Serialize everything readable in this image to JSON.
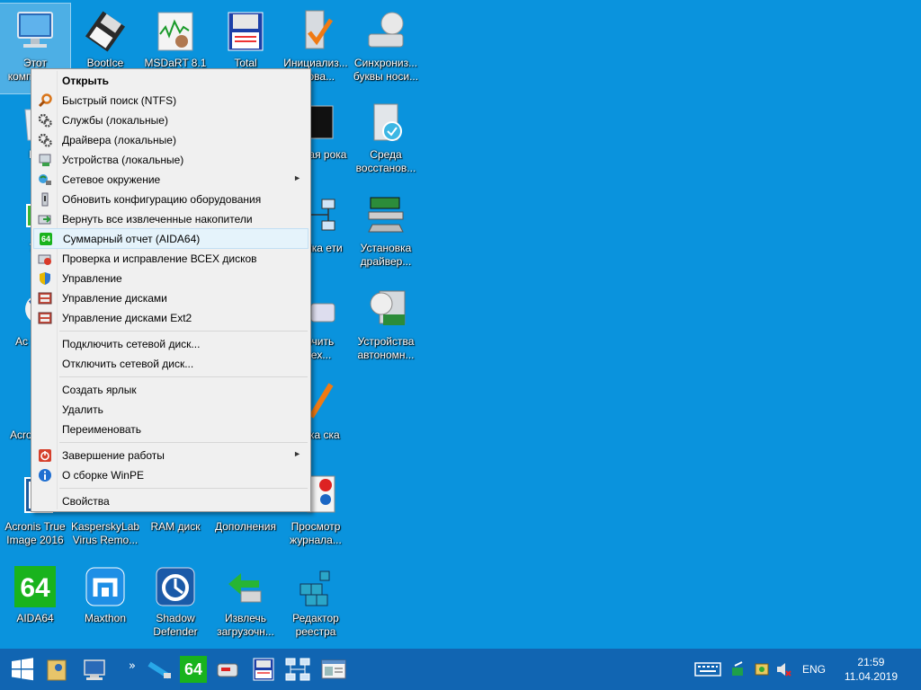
{
  "desktop": {
    "icons": [
      {
        "label": "Этот компьютер",
        "icon": "computer-icon"
      },
      {
        "label": "BootIce",
        "icon": "floppy-icon"
      },
      {
        "label": "MSDaRT 8.1",
        "icon": "msdart-icon"
      },
      {
        "label": "Total",
        "icon": "total-commander-icon"
      },
      {
        "label": "Инициализ... удова...",
        "icon": "init-icon"
      },
      {
        "label": "Синхрониз... буквы носи...",
        "icon": "sync-drives-icon"
      },
      {
        "label": "Ко",
        "icon": "recycle-bin-icon"
      },
      {
        "label": "андная рока",
        "icon": "cmd-icon"
      },
      {
        "label": "Среда восстанов...",
        "icon": "recovery-icon"
      },
      {
        "label": "78",
        "icon": "app-icon"
      },
      {
        "label": "тройка ети",
        "icon": "network-setup-icon"
      },
      {
        "label": "Установка драйвер...",
        "icon": "driver-install-icon"
      },
      {
        "label": "Ac Back",
        "icon": "acronis-backup-icon"
      },
      {
        "label": "лючить всех...",
        "icon": "drive-connect-icon"
      },
      {
        "label": "Устройства автономн...",
        "icon": "offline-devices-icon"
      },
      {
        "label": "Acro Direc",
        "icon": "acronis-director-icon"
      },
      {
        "label": "верка ска",
        "icon": "disk-check-icon"
      },
      {
        "label": "Acronis True Image 2016",
        "icon": "acronis-true-image-icon"
      },
      {
        "label": "KasperskyLab Virus Remo...",
        "icon": "kaspersky-icon"
      },
      {
        "label": "RAM диск",
        "icon": "ram-disk-icon"
      },
      {
        "label": "Дополнения",
        "icon": "addons-icon"
      },
      {
        "label": "Просмотр журнала...",
        "icon": "event-viewer-icon"
      },
      {
        "label": "AIDA64",
        "icon": "aida64-icon"
      },
      {
        "label": "Maxthon",
        "icon": "maxthon-icon"
      },
      {
        "label": "Shadow Defender",
        "icon": "shadow-defender-icon"
      },
      {
        "label": "Извлечь загрузочн...",
        "icon": "eject-usb-icon"
      },
      {
        "label": "Редактор реестра",
        "icon": "registry-editor-icon"
      }
    ]
  },
  "context_menu": {
    "items": [
      {
        "label": "Открыть",
        "bold": true
      },
      {
        "label": "Быстрый поиск (NTFS)",
        "icon": "search-icon"
      },
      {
        "label": "Службы (локальные)",
        "icon": "gears-icon"
      },
      {
        "label": "Драйвера (локальные)",
        "icon": "gears-icon"
      },
      {
        "label": "Устройства (локальные)",
        "icon": "devices-icon"
      },
      {
        "label": "Сетевое окружение",
        "icon": "network-icon",
        "submenu": true
      },
      {
        "label": "Обновить конфигурацию оборудования",
        "icon": "hardware-icon"
      },
      {
        "label": "Вернуть все извлеченные накопители",
        "icon": "drive-return-icon"
      },
      {
        "label": "Суммарный отчет (AIDA64)",
        "icon": "aida64-icon",
        "highlighted": true
      },
      {
        "label": "Проверка и исправление ВСЕХ дисков",
        "icon": "disk-check-icon"
      },
      {
        "label": "Управление",
        "icon": "shield-icon"
      },
      {
        "label": "Управление дисками",
        "icon": "disk-management-icon"
      },
      {
        "label": "Управление дисками Ext2",
        "icon": "disk-management-icon"
      },
      {
        "label": "Подключить сетевой диск..."
      },
      {
        "label": "Отключить сетевой диск..."
      },
      {
        "label": "Создать ярлык"
      },
      {
        "label": "Удалить"
      },
      {
        "label": "Переименовать"
      },
      {
        "label": "Завершение работы",
        "icon": "power-icon",
        "submenu": true
      },
      {
        "label": "О сборке WinPE",
        "icon": "info-icon"
      },
      {
        "label": "Свойства"
      }
    ],
    "submenu_arrow": "►"
  },
  "taskbar": {
    "language": "ENG",
    "time": "21:59",
    "date": "11.04.2019",
    "tray_icons": [
      "keyboard-icon",
      "network-tray-icon",
      "usb-tray-icon",
      "volume-tray-icon"
    ],
    "pinned": [
      "windows-start-icon",
      "explorer-icon",
      "computer-icon",
      "overflow-icon",
      "usb-tool-icon",
      "aida64-icon",
      "disk-tool-icon",
      "total-commander-icon",
      "network-setup-icon",
      "window-icon"
    ],
    "aida_text": "64",
    "overflow_glyph": "»"
  },
  "icon_text": {
    "aida": "64"
  }
}
